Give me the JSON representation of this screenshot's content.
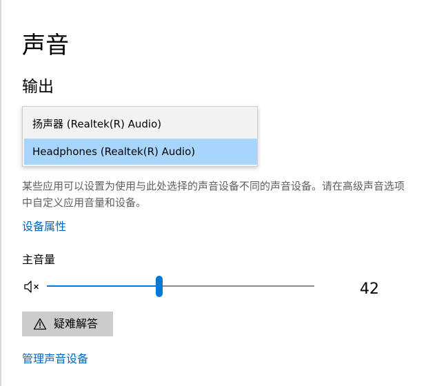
{
  "page": {
    "title": "声音"
  },
  "output": {
    "section_title": "输出",
    "device_dropdown": {
      "options": [
        {
          "label": "扬声器 (Realtek(R) Audio)",
          "selected": false
        },
        {
          "label": "Headphones (Realtek(R) Audio)",
          "selected": true
        }
      ]
    },
    "description": "某些应用可以设置为使用与此处选择的声音设备不同的声音设备。请在高级声音选项中自定义应用音量和设备。",
    "device_properties_link": "设备属性",
    "master_volume": {
      "label": "主音量",
      "value": 42,
      "value_text": "42",
      "muted_icon": "speaker-muted-icon"
    },
    "troubleshoot_button": {
      "label": "疑难解答",
      "icon": "warning-icon"
    },
    "manage_devices_link": "管理声音设备"
  },
  "colors": {
    "accent": "#0078d7",
    "link": "#0067c0",
    "selected_option": "#a8d5fb",
    "button_bg": "#cccccc",
    "description_text": "#5f5f5f"
  }
}
